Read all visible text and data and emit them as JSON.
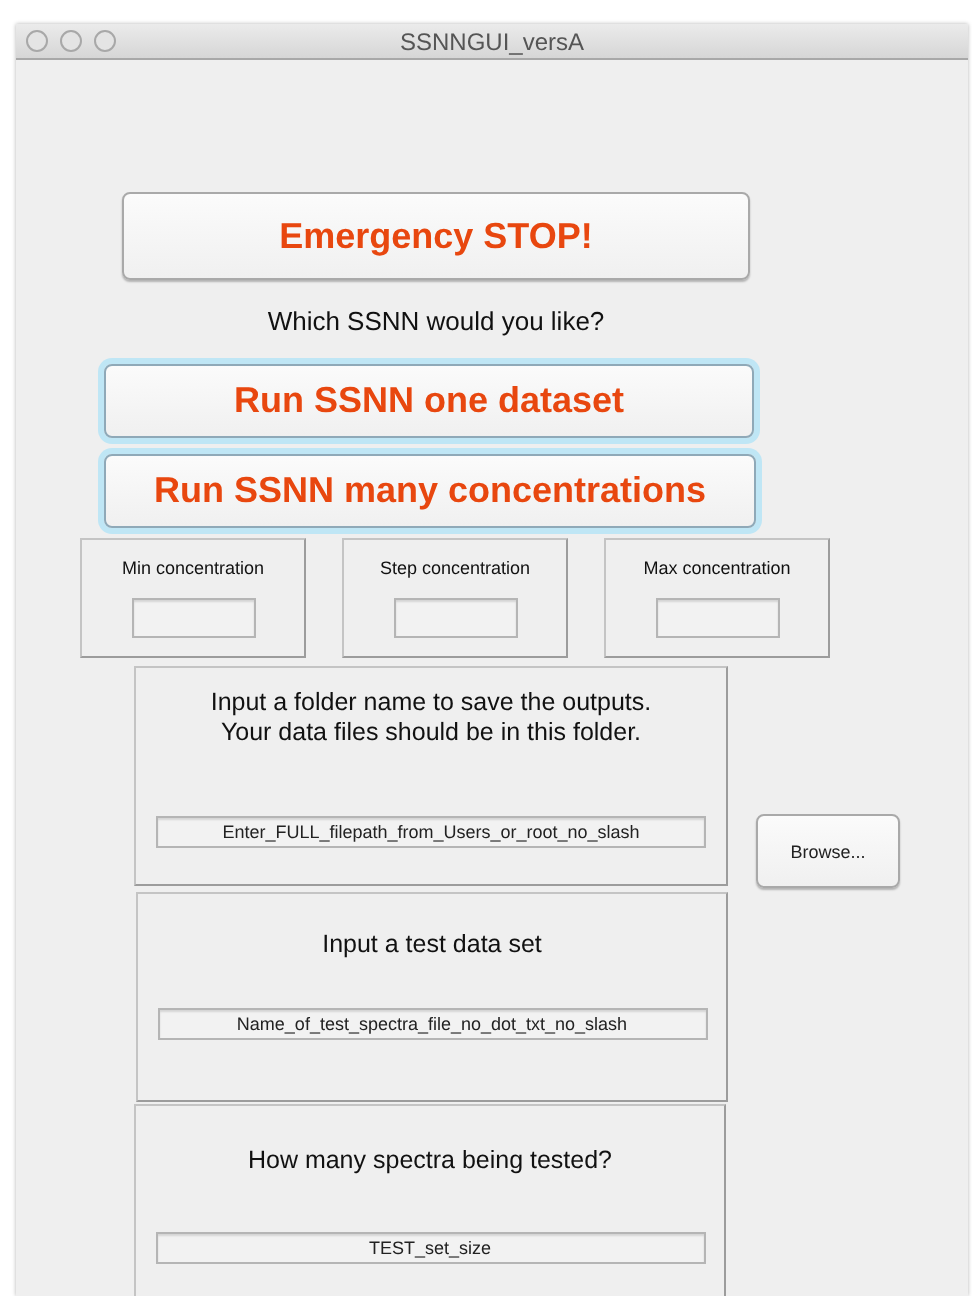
{
  "window": {
    "title": "SSNNGUI_versA"
  },
  "stop_button": {
    "label": "Emergency STOP!"
  },
  "prompt": "Which SSNN would you like?",
  "run_buttons": [
    {
      "label": "Run SSNN one dataset"
    },
    {
      "label": "Run SSNN many concentrations"
    }
  ],
  "concentration_panels": [
    {
      "label": "Min concentration"
    },
    {
      "label": "Step concentration"
    },
    {
      "label": "Max concentration"
    }
  ],
  "folder_panel": {
    "instructions": "Input a folder name to save the outputs.\nYour data files should be in this folder.",
    "value": "Enter_FULL_filepath_from_Users_or_root_no_slash"
  },
  "browse_button": {
    "label": "Browse..."
  },
  "test_panel": {
    "instructions": "Input a test data set",
    "value": "Name_of_test_spectra_file_no_dot_txt_no_slash"
  },
  "spectra_panel": {
    "instructions": "How many spectra being tested?",
    "value": "TEST_set_size"
  }
}
